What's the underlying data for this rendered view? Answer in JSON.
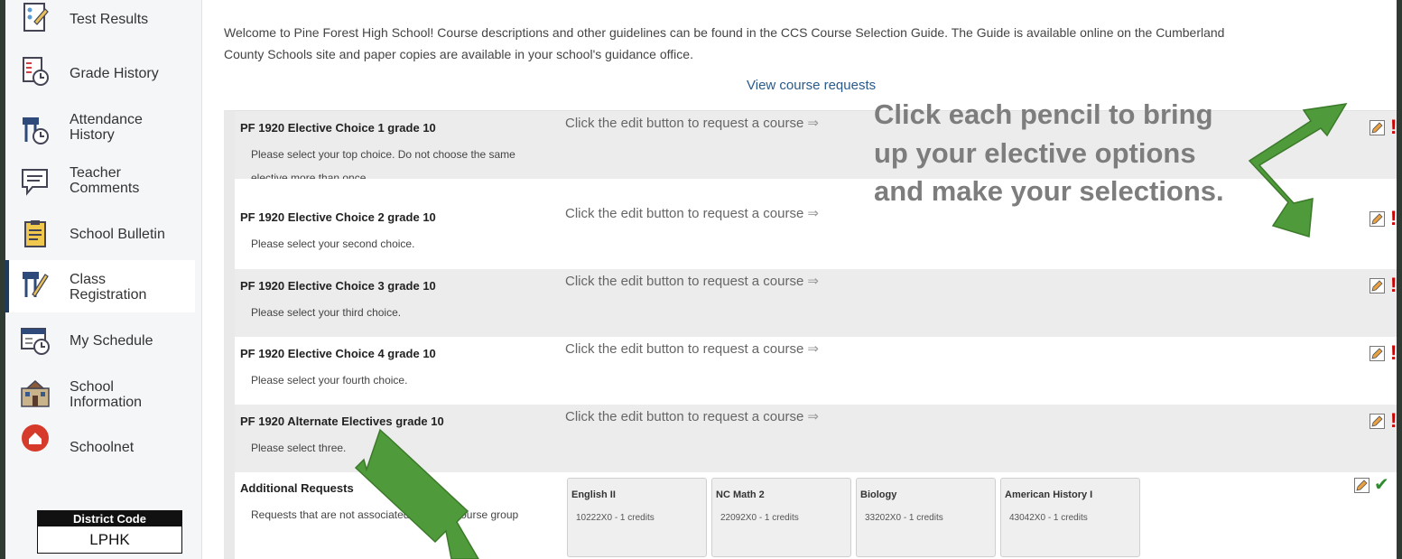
{
  "sidebar": {
    "items": [
      {
        "label": "Test Results",
        "icon": "test-results-icon"
      },
      {
        "label": "Grade History",
        "icon": "grade-history-icon"
      },
      {
        "label": "Attendance History",
        "icon": "attendance-history-icon"
      },
      {
        "label": "Teacher Comments",
        "icon": "teacher-comments-icon"
      },
      {
        "label": "School Bulletin",
        "icon": "school-bulletin-icon"
      },
      {
        "label": "Class Registration",
        "icon": "class-registration-icon",
        "active": true
      },
      {
        "label": "My Schedule",
        "icon": "my-schedule-icon"
      },
      {
        "label": "School Information",
        "icon": "school-information-icon"
      },
      {
        "label": "Schoolnet",
        "icon": "schoolnet-icon"
      }
    ],
    "district": {
      "label": "District Code",
      "value": "LPHK"
    }
  },
  "main": {
    "welcome_line1": "Welcome to Pine Forest High School! Course descriptions and other guidelines can be found in the CCS Course Selection Guide. The Guide is available online on the Cumberland",
    "welcome_line2": "County Schools site and paper copies are available in your school's guidance office.",
    "view_requests": "View course requests",
    "prompt": "Click the edit button to request a course",
    "groups": [
      {
        "title": "PF 1920 Elective Choice 1 grade 10",
        "desc": "Please select your top choice. Do not choose the same elective more than once."
      },
      {
        "title": "PF 1920 Elective Choice 2 grade 10",
        "desc": "Please select your second choice."
      },
      {
        "title": "PF 1920 Elective Choice 3 grade 10",
        "desc": "Please select your third choice."
      },
      {
        "title": "PF 1920 Elective Choice 4 grade 10",
        "desc": "Please select your fourth choice."
      },
      {
        "title": "PF 1920 Alternate Electives grade 10",
        "desc": "Please select three."
      }
    ],
    "additional": {
      "title": "Additional Requests",
      "desc": "Requests that are not associated with any course group",
      "courses": [
        {
          "name": "English II",
          "code": "10222X0 - 1 credits"
        },
        {
          "name": "NC Math 2",
          "code": "22092X0 - 1 credits"
        },
        {
          "name": "Biology",
          "code": "33202X0 - 1 credits"
        },
        {
          "name": "American History I",
          "code": "43042X0 - 1 credits"
        }
      ]
    },
    "callout": "Click each pencil to bring up your elective options and make your selections."
  },
  "colors": {
    "accent_arrow": "#4f9a3a",
    "error_flag": "#cc0000",
    "ok_check": "#2e8b2e",
    "link": "#2a5a8a"
  },
  "icons": {
    "edit": "pencil-icon",
    "required": "exclamation-icon",
    "complete": "checkmark-icon",
    "prompt_arrow": "arrow-right-icon"
  }
}
